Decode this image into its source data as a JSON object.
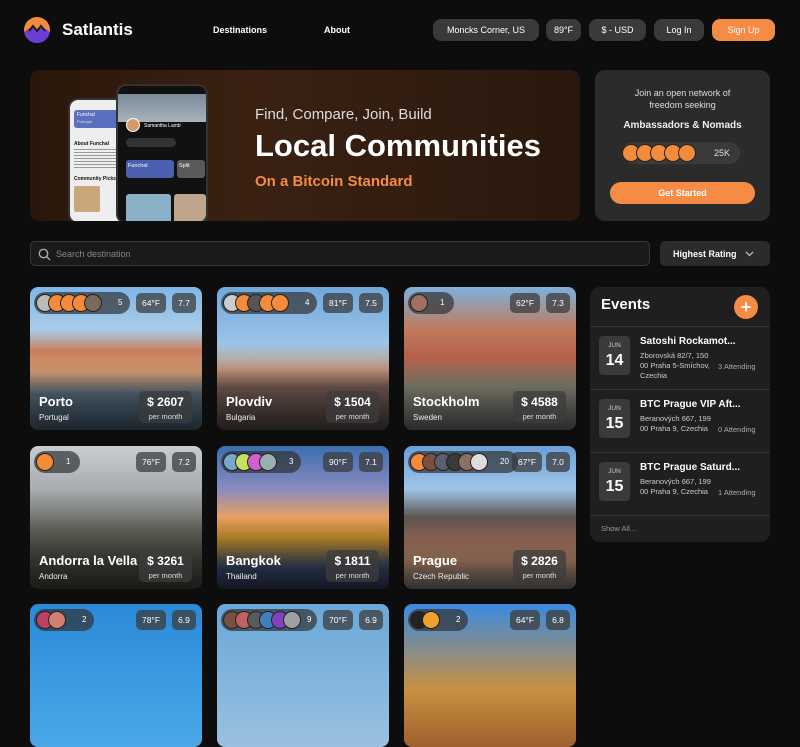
{
  "brand": "Satlantis",
  "nav": {
    "destinations": "Destinations",
    "about": "About"
  },
  "header_pills": {
    "location": "Moncks Corner, US",
    "temp": "89°F",
    "currency": "$ - USD",
    "login": "Log In",
    "signup": "Sign Up"
  },
  "hero": {
    "kicker": "Find, Compare, Join, Build",
    "title": "Local Communities",
    "subtitle": "On a Bitcoin Standard",
    "phone": {
      "city1": "Funchal",
      "country1": "Portugal",
      "about": "About Funchal",
      "picks": "Community Picks",
      "city2": "Funchal",
      "city3": "Split",
      "user": "Samantha Lamb"
    }
  },
  "join": {
    "text": "Join an open network of freedom seeking",
    "highlight": "Ambassadors & Nomads",
    "count": "25K",
    "button": "Get Started"
  },
  "search": {
    "placeholder": "Search destination"
  },
  "sort": {
    "label": "Highest Rating"
  },
  "cards": [
    {
      "city": "Porto",
      "country": "Portugal",
      "price": "$ 2607",
      "per": "per month",
      "members": "5",
      "temp": "64°F",
      "rating": "7.7"
    },
    {
      "city": "Plovdiv",
      "country": "Bulgaria",
      "price": "$ 1504",
      "per": "per month",
      "members": "4",
      "temp": "81°F",
      "rating": "7.5"
    },
    {
      "city": "Stockholm",
      "country": "Sweden",
      "price": "$ 4588",
      "per": "per month",
      "members": "1",
      "temp": "62°F",
      "rating": "7.3"
    },
    {
      "city": "Andorra la Vella",
      "country": "Andorra",
      "price": "$ 3261",
      "per": "per month",
      "members": "1",
      "temp": "76°F",
      "rating": "7.2"
    },
    {
      "city": "Bangkok",
      "country": "Thailand",
      "price": "$ 1811",
      "per": "per month",
      "members": "3",
      "temp": "90°F",
      "rating": "7.1"
    },
    {
      "city": "Prague",
      "country": "Czech Republic",
      "price": "$ 2826",
      "per": "per month",
      "members": "20",
      "temp": "67°F",
      "rating": "7.0"
    },
    {
      "members": "2",
      "temp": "78°F",
      "rating": "6.9"
    },
    {
      "members": "9",
      "temp": "70°F",
      "rating": "6.9"
    },
    {
      "members": "2",
      "temp": "64°F",
      "rating": "6.8"
    }
  ],
  "events": {
    "title": "Events",
    "items": [
      {
        "month": "JUN",
        "day": "14",
        "title": "Satoshi Rockamot...",
        "address": "Zborovská 82/7, 150 00 Praha 5-Smíchov, Czechia",
        "attending": "3 Attending"
      },
      {
        "month": "JUN",
        "day": "15",
        "title": "BTC Prague VIP Aft...",
        "address": "Beranových 667, 199 00 Praha 9, Czechia",
        "attending": "0 Attending"
      },
      {
        "month": "JUN",
        "day": "15",
        "title": "BTC Prague Saturd...",
        "address": "Beranových 667, 199 00 Praha 9, Czechia",
        "attending": "1 Attending"
      }
    ],
    "show_all": "Show All..."
  },
  "colors": {
    "accent": "#f68b46",
    "background": "#0d0d0d",
    "panel": "#2b2b2b"
  }
}
